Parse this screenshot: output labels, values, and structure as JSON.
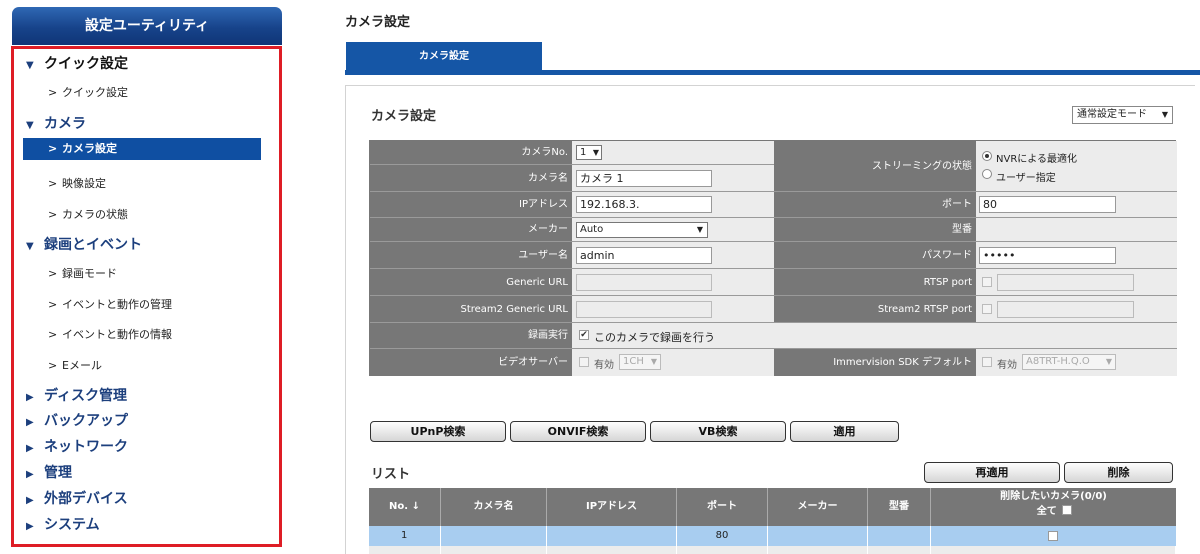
{
  "sidebar": {
    "title": "設定ユーティリティ",
    "groups": [
      {
        "label": "クイック設定",
        "items": [
          "クイック設定"
        ]
      },
      {
        "label": "カメラ",
        "items": [
          "カメラ設定",
          "映像設定",
          "カメラの状態"
        ]
      },
      {
        "label": "録画とイベント",
        "items": [
          "録画モード",
          "イベントと動作の管理",
          "イベントと動作の情報",
          "Eメール"
        ]
      },
      {
        "label": "ディスク管理"
      },
      {
        "label": "バックアップ"
      },
      {
        "label": "ネットワーク"
      },
      {
        "label": "管理"
      },
      {
        "label": "外部デバイス"
      },
      {
        "label": "システム"
      }
    ],
    "sub_marker": ">",
    "active_item": "カメラ設定"
  },
  "main": {
    "page_title": "カメラ設定",
    "tab_label": "カメラ設定",
    "section_title": "カメラ設定",
    "mode_select": "通常設定モード",
    "form": {
      "camera_no_label": "カメラNo.",
      "camera_no_value": "1",
      "camera_name_label": "カメラ名",
      "camera_name_value": "カメラ 1",
      "streaming_label": "ストリーミングの状態",
      "streaming_opt1": "NVRによる最適化",
      "streaming_opt2": "ユーザー指定",
      "ip_label": "IPアドレス",
      "ip_value": "192.168.3.",
      "port_label": "ポート",
      "port_value": "80",
      "maker_label": "メーカー",
      "maker_value": "Auto",
      "model_label": "型番",
      "username_label": "ユーザー名",
      "username_value": "admin",
      "password_label": "パスワード",
      "password_value": "•••••",
      "generic_url_label": "Generic URL",
      "rtsp_port_label": "RTSP port",
      "stream2_url_label": "Stream2 Generic URL",
      "stream2_rtsp_label": "Stream2 RTSP port",
      "record_label": "録画実行",
      "record_check": "このカメラで録画を行う",
      "video_server_label": "ビデオサーバー",
      "enabled_label": "有効",
      "video_server_ch": "1CH",
      "immervision_label": "Immervision SDK デフォルト",
      "immervision_value": "A8TRT-H.Q.O"
    },
    "buttons": {
      "upnp": "UPnP検索",
      "onvif": "ONVIF検索",
      "vb": "VB検索",
      "apply": "適用",
      "reapply": "再適用",
      "delete": "削除"
    },
    "list": {
      "title": "リスト",
      "columns": [
        "No. ↓",
        "カメラ名",
        "IPアドレス",
        "ポート",
        "メーカー",
        "型番",
        "削除したいカメラ(0/0)"
      ],
      "all_label": "全て",
      "rows": [
        {
          "no": "1",
          "name": "",
          "ip": "",
          "port": "80",
          "maker": "",
          "model": ""
        }
      ]
    }
  },
  "colors": {
    "accent": "#1556a6",
    "frame_red": "#de1d25",
    "label_gray": "#777777",
    "row_highlight": "#a8cdf0"
  }
}
